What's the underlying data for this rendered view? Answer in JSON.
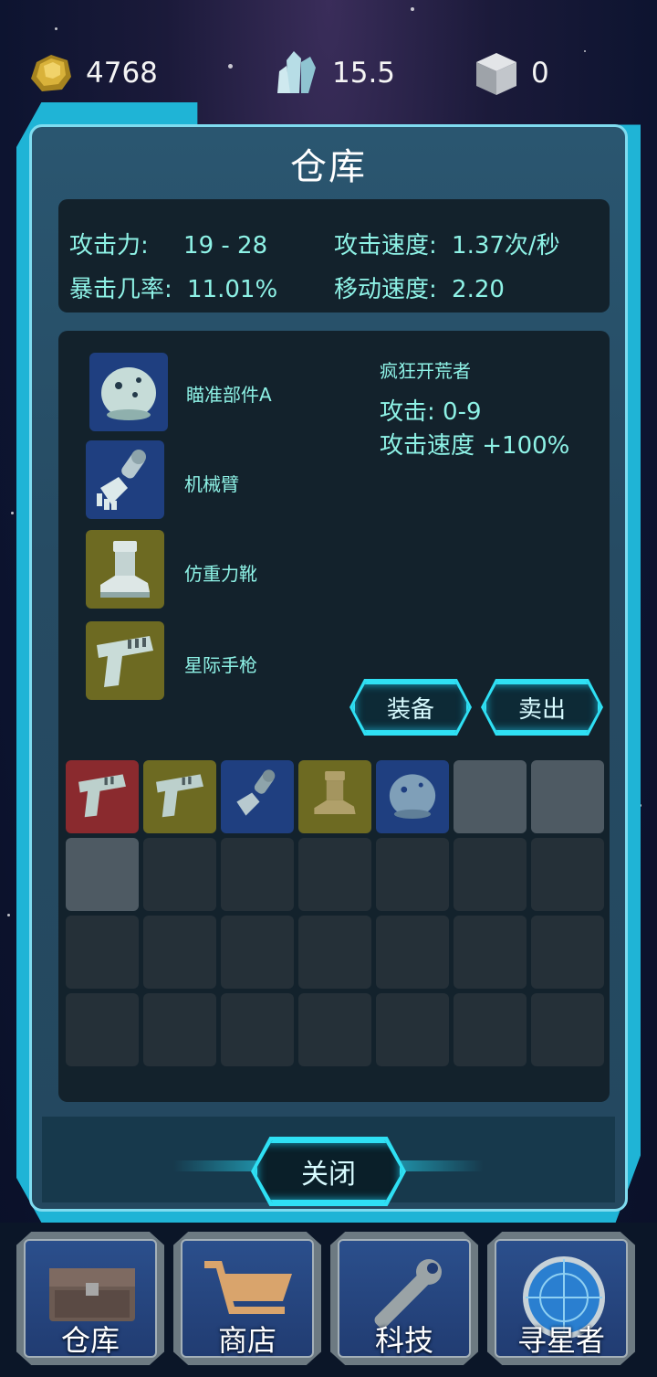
{
  "resources": {
    "gold": {
      "value": "4768",
      "icon": "gold-nugget-icon"
    },
    "crystal": {
      "value": "15.5",
      "icon": "crystal-icon"
    },
    "block": {
      "value": "0",
      "icon": "metal-cube-icon"
    }
  },
  "panel": {
    "title": "仓库",
    "stats": {
      "attack_label": "攻击力:",
      "attack_value": "19 - 28",
      "attack_speed_label": "攻击速度:",
      "attack_speed_value": "1.37次/秒",
      "crit_label": "暴击几率:",
      "crit_value": "11.01%",
      "move_speed_label": "移动速度:",
      "move_speed_value": "2.20"
    },
    "equipped": [
      {
        "label": "瞄准部件A",
        "icon": "helmet-icon",
        "color": "#1f3f80"
      },
      {
        "label": "机械臂",
        "icon": "mech-arm-icon",
        "color": "#1f3f80"
      },
      {
        "label": "仿重力靴",
        "icon": "boot-icon",
        "color": "#6d6a22"
      },
      {
        "label": "星际手枪",
        "icon": "pistol-icon",
        "color": "#6d6a22"
      }
    ],
    "detail": {
      "name": "疯狂开荒者",
      "line1": "攻击: 0-9",
      "line2": "攻击速度 +100%"
    },
    "buttons": {
      "equip": "装备",
      "sell": "卖出",
      "close": "关闭"
    },
    "inventory": [
      {
        "icon": "pistol-icon",
        "color": "red"
      },
      {
        "icon": "pistol-icon",
        "color": "olive"
      },
      {
        "icon": "mech-arm-icon",
        "color": "blue"
      },
      {
        "icon": "boot-icon",
        "color": "olive"
      },
      {
        "icon": "helmet-icon",
        "color": "blue"
      },
      {
        "icon": "",
        "color": "light"
      },
      {
        "icon": "",
        "color": "light"
      },
      {
        "icon": "",
        "color": "light"
      }
    ],
    "inventory_total_slots": 28
  },
  "nav": [
    {
      "label": "仓库",
      "icon": "chest-icon"
    },
    {
      "label": "商店",
      "icon": "cart-icon"
    },
    {
      "label": "科技",
      "icon": "wrench-icon"
    },
    {
      "label": "寻星者",
      "icon": "radar-icon"
    }
  ]
}
